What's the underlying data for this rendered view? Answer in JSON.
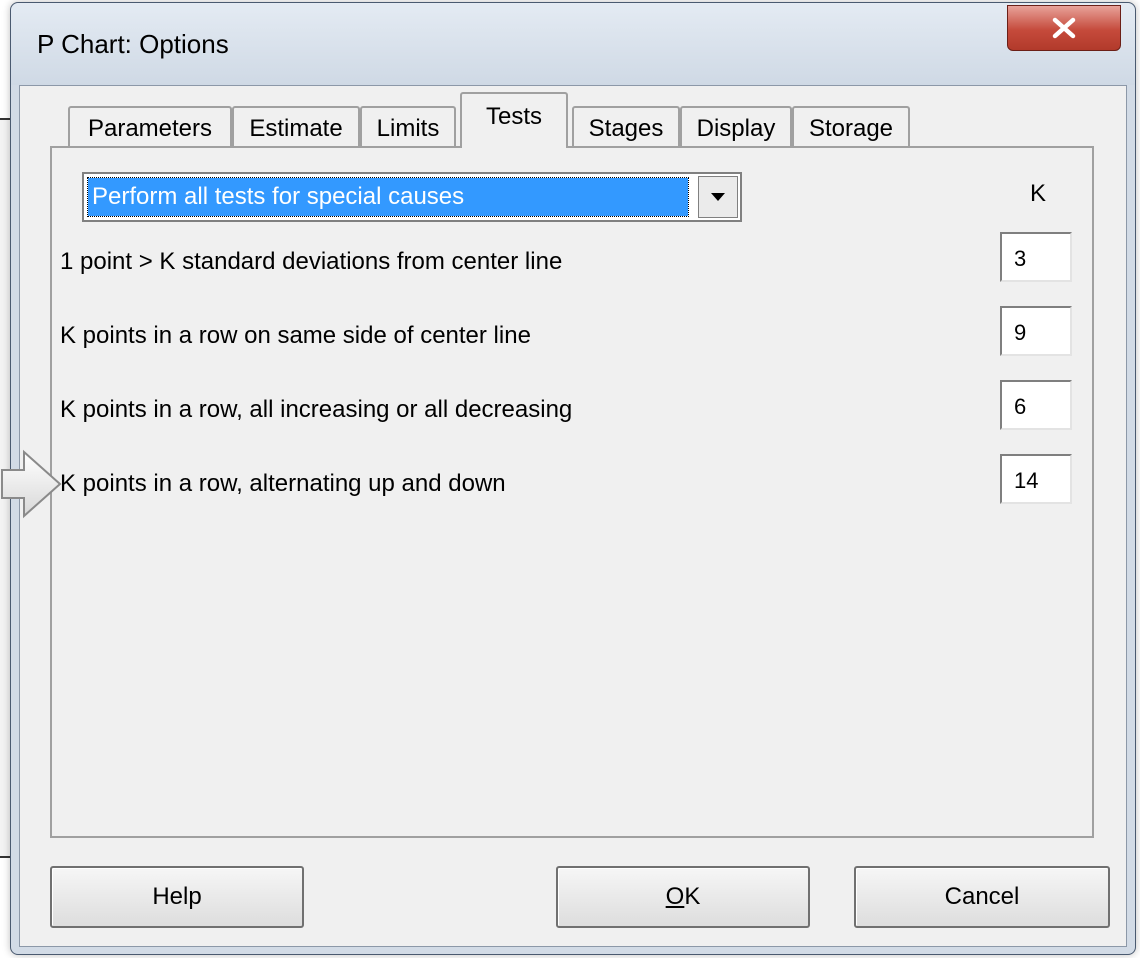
{
  "window": {
    "title": "P Chart: Options",
    "close_label": "X"
  },
  "tabs": [
    {
      "label": "Parameters",
      "active": false
    },
    {
      "label": "Estimate",
      "active": false
    },
    {
      "label": "Limits",
      "active": false
    },
    {
      "label": "Tests",
      "active": true
    },
    {
      "label": "Stages",
      "active": false
    },
    {
      "label": "Display",
      "active": false
    },
    {
      "label": "Storage",
      "active": false
    }
  ],
  "tests_panel": {
    "dropdown_selected": "Perform all tests for special causes",
    "k_header": "K",
    "tests": [
      {
        "label": "1 point > K standard deviations from center line",
        "k": "3"
      },
      {
        "label": "K points in a row on same side of center line",
        "k": "9"
      },
      {
        "label": "K points in a row, all increasing or all decreasing",
        "k": "6"
      },
      {
        "label": "K points in a row, alternating up and down",
        "k": "14"
      }
    ]
  },
  "buttons": {
    "help": "Help",
    "ok_mnemonic": "O",
    "ok_rest": "K",
    "cancel": "Cancel"
  },
  "colors": {
    "selection": "#3399ff",
    "close_button": "#c54a3b",
    "dialog_bg": "#f0f0f0"
  }
}
